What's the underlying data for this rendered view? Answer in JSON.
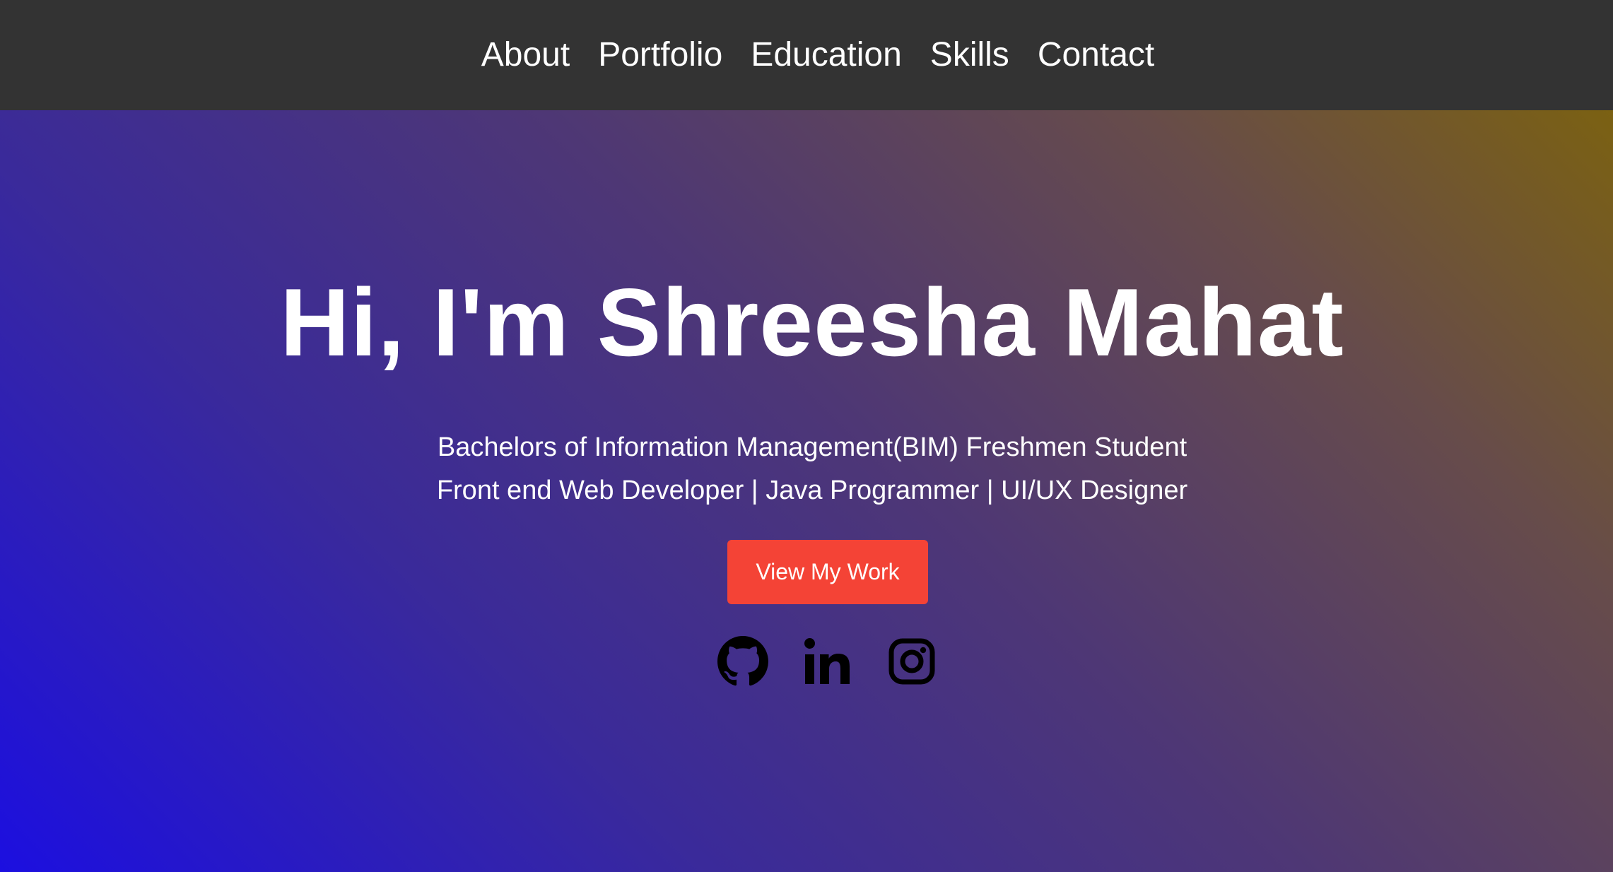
{
  "nav": {
    "items": [
      {
        "label": "About"
      },
      {
        "label": "Portfolio"
      },
      {
        "label": "Education"
      },
      {
        "label": "Skills"
      },
      {
        "label": "Contact"
      }
    ]
  },
  "hero": {
    "title": "Hi, I'm Shreesha Mahat",
    "subtitle_line1": "Bachelors of Information Management(BIM) Freshmen Student",
    "subtitle_line2": "Front end Web Developer | Java Programmer | UI/UX Designer",
    "cta_label": "View My Work"
  },
  "social": [
    {
      "icon": "github-icon"
    },
    {
      "icon": "linkedin-icon"
    },
    {
      "icon": "instagram-icon"
    }
  ],
  "colors": {
    "navbar_bg": "#333333",
    "cta_bg": "#f44336",
    "gradient_start": "#1c0fe0",
    "gradient_end": "#7b6112",
    "text": "#ffffff",
    "icon": "#000000"
  }
}
